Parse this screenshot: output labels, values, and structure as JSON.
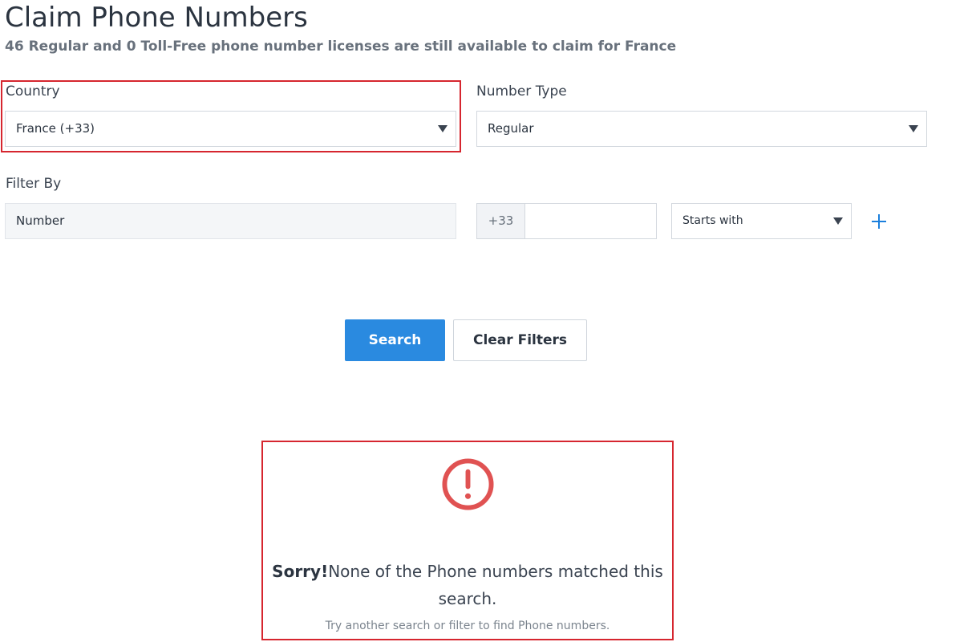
{
  "page": {
    "title": "Claim Phone Numbers",
    "subtitle": "46 Regular and 0 Toll-Free phone number licenses are still available to claim for France"
  },
  "country": {
    "label": "Country",
    "value": "France (+33)"
  },
  "number_type": {
    "label": "Number Type",
    "value": "Regular"
  },
  "filter": {
    "label": "Filter By",
    "field_value": "Number",
    "prefix": "+33",
    "number_value": "",
    "match_value": "Starts with"
  },
  "actions": {
    "search_label": "Search",
    "clear_label": "Clear Filters"
  },
  "empty_state": {
    "emphasis": "Sorry!",
    "message": "None of the Phone numbers matched this search.",
    "hint": "Try another search or filter to find Phone numbers."
  },
  "colors": {
    "accent": "#2a8ae0",
    "error": "#e05252",
    "highlight": "#d6262f"
  },
  "icons": {
    "empty_state": "alert-circle-icon",
    "add_filter": "plus-icon",
    "dropdown": "caret-down-icon"
  }
}
